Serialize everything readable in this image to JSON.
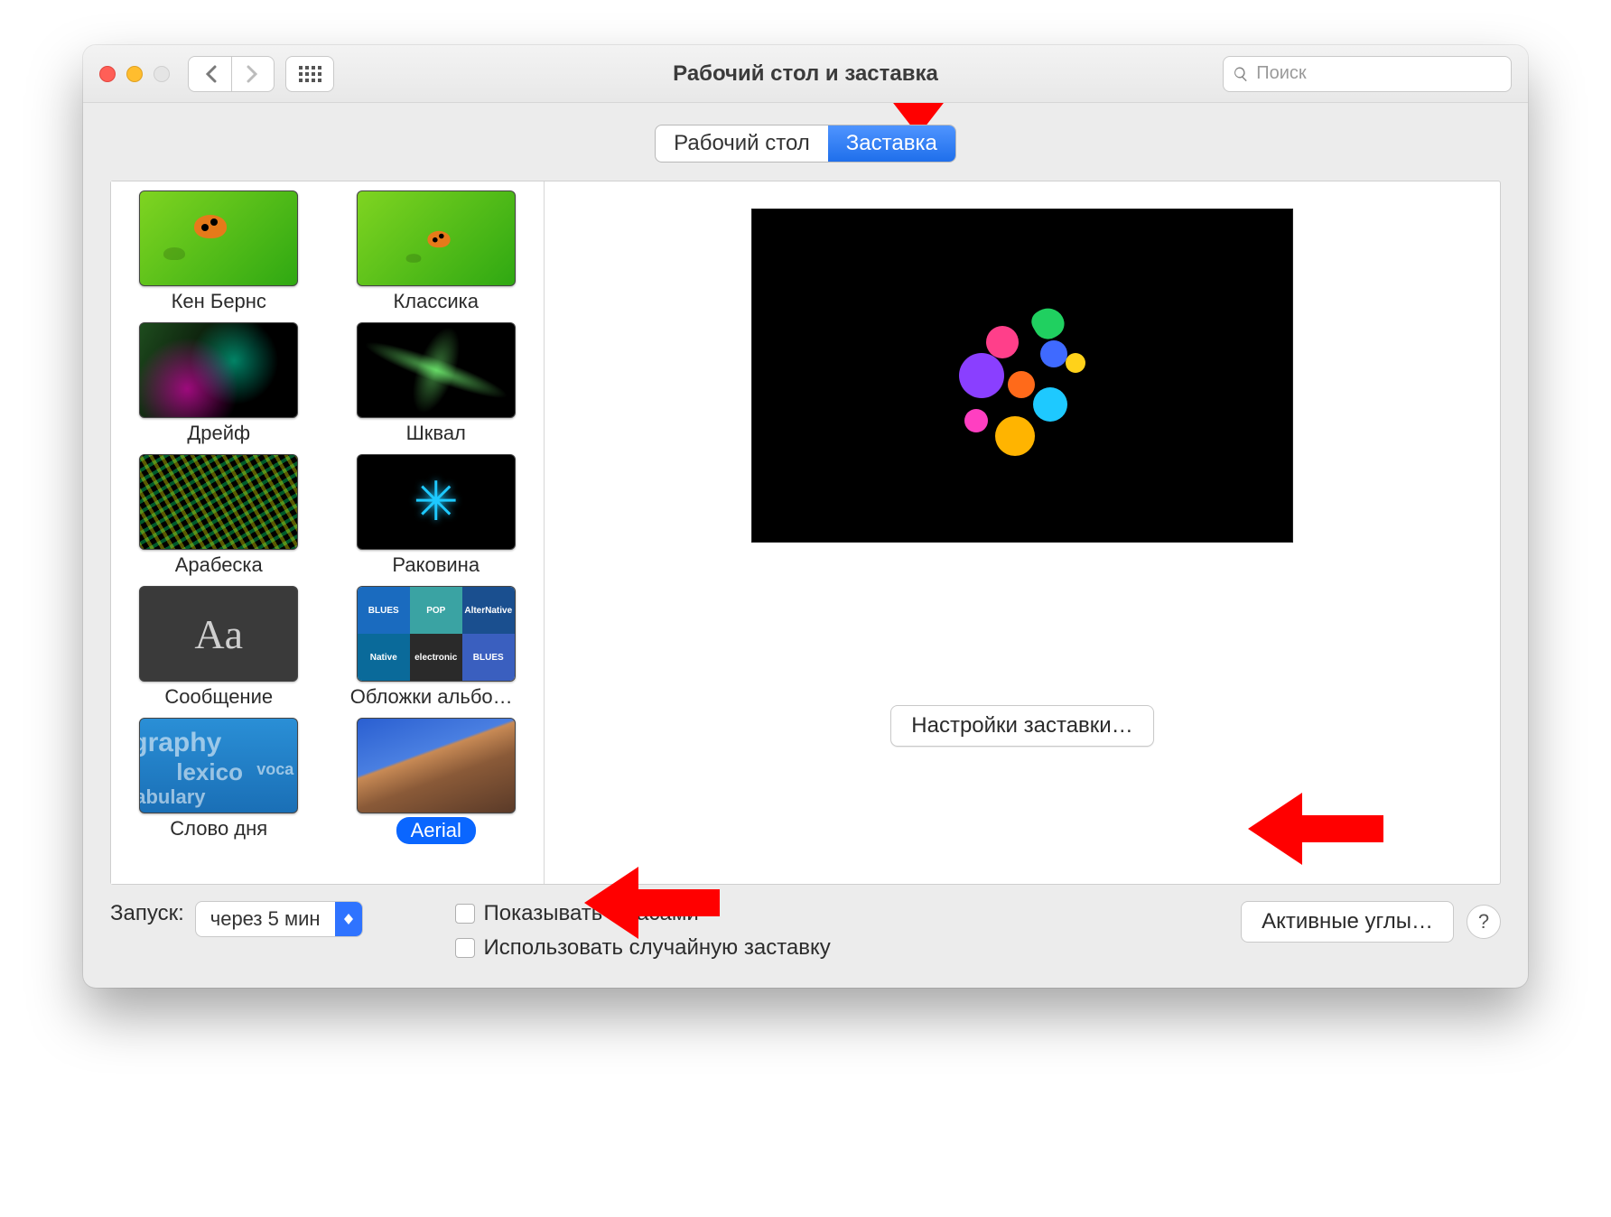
{
  "window": {
    "title": "Рабочий стол и заставка"
  },
  "search": {
    "placeholder": "Поиск"
  },
  "tabs": {
    "desktop": "Рабочий стол",
    "screensaver": "Заставка"
  },
  "screensavers": [
    {
      "id": "ken-burns",
      "label": "Кен Бернс"
    },
    {
      "id": "classic",
      "label": "Классика"
    },
    {
      "id": "drift",
      "label": "Дрейф"
    },
    {
      "id": "flurry",
      "label": "Шквал"
    },
    {
      "id": "arabesque",
      "label": "Арабеска"
    },
    {
      "id": "shell",
      "label": "Раковина"
    },
    {
      "id": "message",
      "label": "Сообщение"
    },
    {
      "id": "album-covers",
      "label": "Обложки альбом…"
    },
    {
      "id": "word-of-day",
      "label": "Слово дня"
    },
    {
      "id": "aerial",
      "label": "Aerial",
      "selected": true
    }
  ],
  "preview": {
    "options_button": "Настройки заставки…"
  },
  "bottom": {
    "start_label": "Запуск:",
    "start_value": "через 5 мин",
    "show_clock": "Показывать с часами",
    "random": "Использовать случайную заставку",
    "hot_corners": "Активные углы…"
  },
  "msg_thumb_text": "Aa",
  "word_thumb": {
    "w1": "graphy",
    "w2": "voca",
    "w3": "lexico",
    "w4": "abulary"
  },
  "covers_thumb": [
    "BLUES",
    "POP",
    "AlterNative",
    "Native",
    "electronic",
    "BLUES"
  ]
}
